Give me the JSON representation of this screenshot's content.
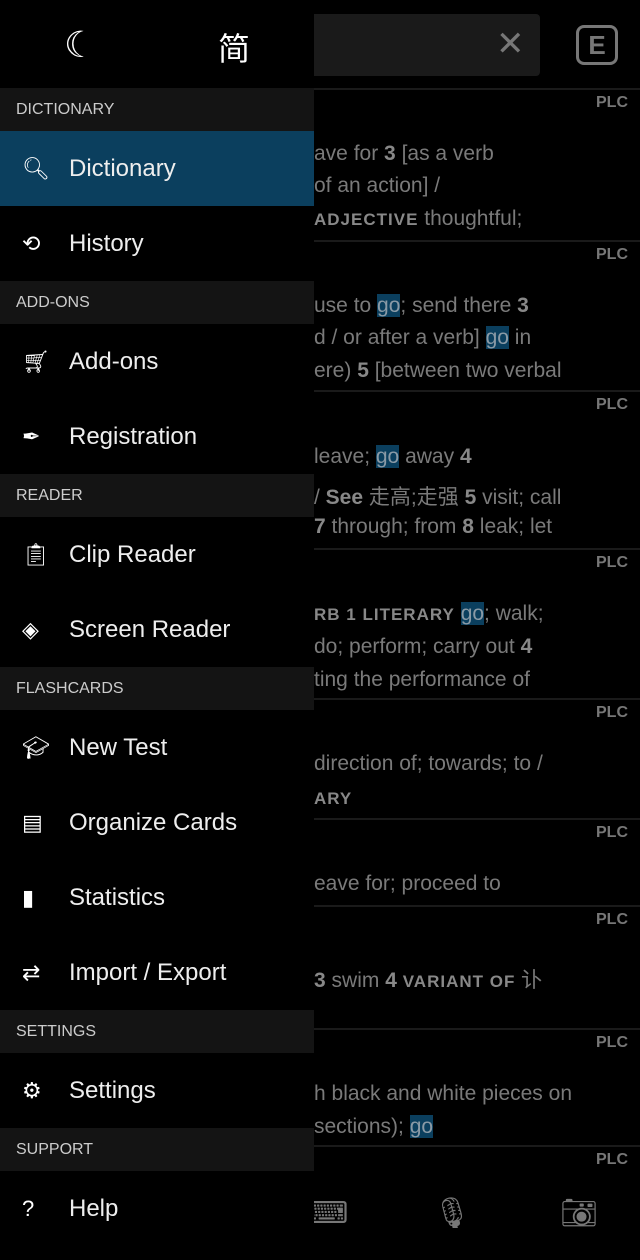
{
  "drawer": {
    "top": {
      "theme_icon": "moon-icon",
      "script_toggle": "简"
    },
    "sections": [
      {
        "header": "DICTIONARY",
        "items": [
          {
            "label": "Dictionary",
            "icon": "search-icon",
            "glyph": "🔍︎",
            "active": true
          },
          {
            "label": "History",
            "icon": "history-icon",
            "glyph": "⟲"
          }
        ]
      },
      {
        "header": "ADD-ONS",
        "items": [
          {
            "label": "Add-ons",
            "icon": "cart-icon",
            "glyph": "🛒︎"
          },
          {
            "label": "Registration",
            "icon": "feather-icon",
            "glyph": "✒"
          }
        ]
      },
      {
        "header": "READER",
        "items": [
          {
            "label": "Clip Reader",
            "icon": "clipboard-icon",
            "glyph": "📋︎"
          },
          {
            "label": "Screen Reader",
            "icon": "layers-icon",
            "glyph": "◈"
          }
        ]
      },
      {
        "header": "FLASHCARDS",
        "items": [
          {
            "label": "New Test",
            "icon": "graduation-cap-icon",
            "glyph": "🎓︎"
          },
          {
            "label": "Organize Cards",
            "icon": "archive-icon",
            "glyph": "▤"
          },
          {
            "label": "Statistics",
            "icon": "bar-chart-icon",
            "glyph": "▮"
          },
          {
            "label": "Import / Export",
            "icon": "swap-icon",
            "glyph": "⇄"
          }
        ]
      },
      {
        "header": "SETTINGS",
        "items": [
          {
            "label": "Settings",
            "icon": "gear-icon",
            "glyph": "⚙"
          }
        ]
      },
      {
        "header": "SUPPORT",
        "items": [
          {
            "label": "Help",
            "icon": "help-icon",
            "glyph": "?"
          }
        ]
      }
    ]
  },
  "main": {
    "clear_icon": "close-icon",
    "clear_glyph": "✕",
    "mode_button": "E",
    "source_label": "PLC",
    "lines": [
      [
        {
          "t": "ave for "
        },
        {
          "t": "3",
          "s": "b"
        },
        {
          "t": " [as a verb"
        }
      ],
      [
        {
          "t": "of an action]  /"
        }
      ],
      [
        {
          "t": "ADJECTIVE",
          "s": "sc"
        },
        {
          "t": " thoughtful;"
        }
      ],
      [
        {
          "t": "use to "
        },
        {
          "t": "go",
          "s": "hl"
        },
        {
          "t": "; send there  "
        },
        {
          "t": "3",
          "s": "b"
        }
      ],
      [
        {
          "t": "d / or after a verb] "
        },
        {
          "t": "go",
          "s": "hl"
        },
        {
          "t": " in"
        }
      ],
      [
        {
          "t": "ere)  "
        },
        {
          "t": "5",
          "s": "b"
        },
        {
          "t": " [between two verbal"
        }
      ],
      [
        {
          "t": " leave; "
        },
        {
          "t": "go",
          "s": "hl"
        },
        {
          "t": " away  "
        },
        {
          "t": "4",
          "s": "b"
        }
      ],
      [
        {
          "t": "/ "
        },
        {
          "t": "See",
          "s": "b"
        },
        {
          "t": " 走高;走强   "
        },
        {
          "t": "5",
          "s": "b"
        },
        {
          "t": " visit; call"
        }
      ],
      [
        {
          "t": "7",
          "s": "b"
        },
        {
          "t": " through; from  "
        },
        {
          "t": "8",
          "s": "b"
        },
        {
          "t": " leak; let"
        }
      ],
      [
        {
          "t": "RB  1  ",
          "s": "sc"
        },
        {
          "t": "LITERARY",
          "s": "sc"
        },
        {
          "t": " "
        },
        {
          "t": "go",
          "s": "hl"
        },
        {
          "t": "; walk;"
        }
      ],
      [
        {
          "t": " do; perform; carry out  "
        },
        {
          "t": "4",
          "s": "b"
        }
      ],
      [
        {
          "t": "ting the performance of"
        }
      ],
      [
        {
          "t": "direction of; towards; to /"
        }
      ],
      [
        {
          "t": "ARY",
          "s": "sc"
        }
      ],
      [
        {
          "t": "eave for; proceed to"
        }
      ],
      [
        {
          "t": "  "
        },
        {
          "t": "3",
          "s": "b"
        },
        {
          "t": " swim  "
        },
        {
          "t": "4",
          "s": "b"
        },
        {
          "t": "  "
        },
        {
          "t": "VARIANT OF",
          "s": "sc"
        },
        {
          "t": " 讣"
        }
      ],
      [
        {
          "t": "h black and white pieces on"
        }
      ],
      [
        {
          "t": "sections); "
        },
        {
          "t": "go",
          "s": "hl"
        }
      ]
    ],
    "bottom_icons": [
      {
        "icon": "keyboard-icon",
        "glyph": "⌨"
      },
      {
        "icon": "microphone-icon",
        "glyph": "🎙︎"
      },
      {
        "icon": "camera-icon",
        "glyph": "📷︎"
      }
    ]
  },
  "colors": {
    "accent": "#0b3f5e",
    "background": "#000000",
    "section_header": "#141414"
  }
}
